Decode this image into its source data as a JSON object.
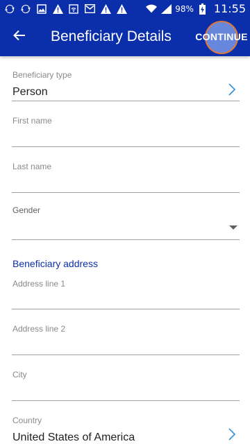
{
  "status_bar": {
    "left_icons": [
      "sync-icon",
      "sync-icon",
      "image-icon",
      "warning-icon",
      "wifi-call-icon",
      "gmail-icon",
      "warning-icon",
      "warning-icon"
    ],
    "battery_percent": "98%",
    "time": "11:55"
  },
  "app_bar": {
    "title": "Beneficiary Details",
    "continue_label": "CONTINUE",
    "bg_color": "#0b2faa"
  },
  "form": {
    "beneficiary_type": {
      "label": "Beneficiary type",
      "value": "Person"
    },
    "first_name": {
      "label": "First name",
      "value": ""
    },
    "last_name": {
      "label": "Last name",
      "value": ""
    },
    "gender": {
      "label": "Gender",
      "value": ""
    },
    "address_section_title": "Beneficiary address",
    "address_line_1": {
      "label": "Address line 1",
      "value": ""
    },
    "address_line_2": {
      "label": "Address line 2",
      "value": ""
    },
    "city": {
      "label": "City",
      "value": ""
    },
    "country": {
      "label": "Country",
      "value": "United States of America"
    }
  }
}
